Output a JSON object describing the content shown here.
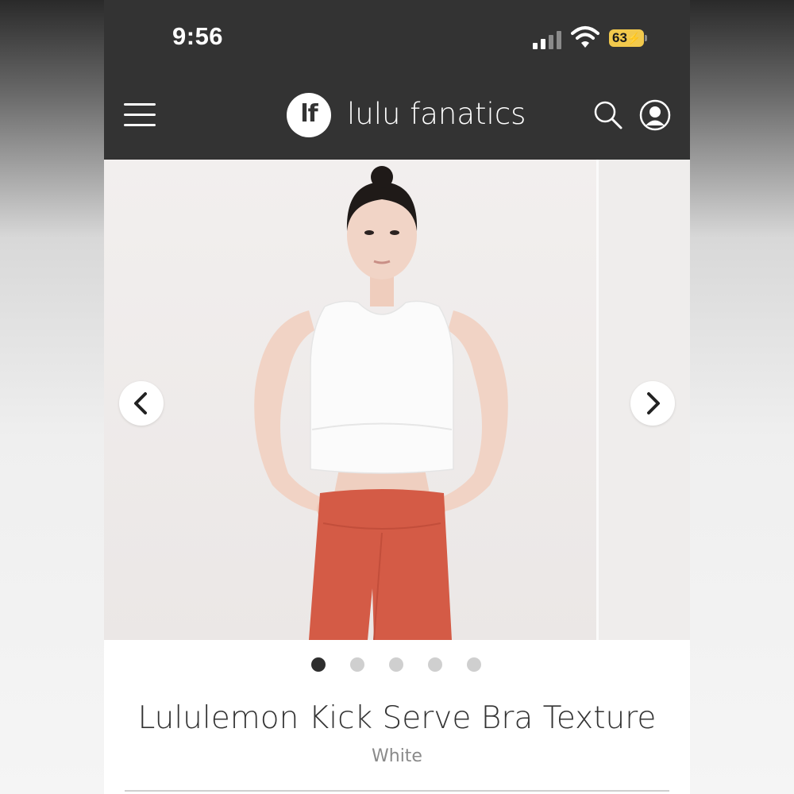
{
  "status_bar": {
    "time": "9:56",
    "battery_level": "63",
    "signal_icon": "cellular-signal-icon",
    "wifi_icon": "wifi-icon"
  },
  "header": {
    "logo_text": "lf",
    "brand_name": "lulu fanatics",
    "menu_icon": "hamburger-menu-icon",
    "search_icon": "search-icon",
    "account_icon": "user-account-icon",
    "background_color": "#333333"
  },
  "gallery": {
    "image_subject": "product-photo",
    "prev_icon": "chevron-left-icon",
    "next_icon": "chevron-right-icon",
    "total_images": 5,
    "active_index": 0
  },
  "product": {
    "title": "Lululemon Kick Serve Bra Texture",
    "color": "White"
  }
}
